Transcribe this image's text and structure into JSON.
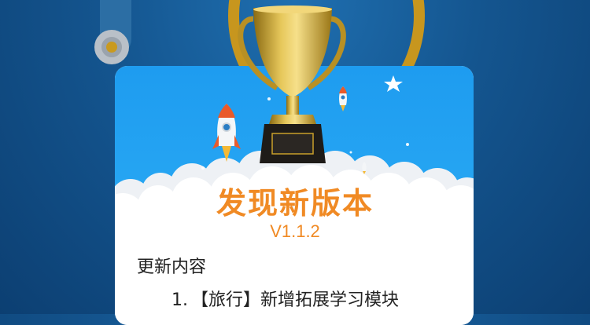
{
  "dialog": {
    "title": "发现新版本",
    "version": "V1.1.2",
    "section_title": "更新内容",
    "items": [
      {
        "number": "1.",
        "text": "【旅行】新增拓展学习模块"
      }
    ]
  },
  "colors": {
    "banner_blue": "#1a9aee",
    "accent_orange": "#f08a24",
    "trophy_gold": "#c9a02a",
    "background_blue": "#14558f"
  },
  "icons": [
    "trophy-icon",
    "rocket-icon",
    "star-icon",
    "cloud-decoration"
  ]
}
